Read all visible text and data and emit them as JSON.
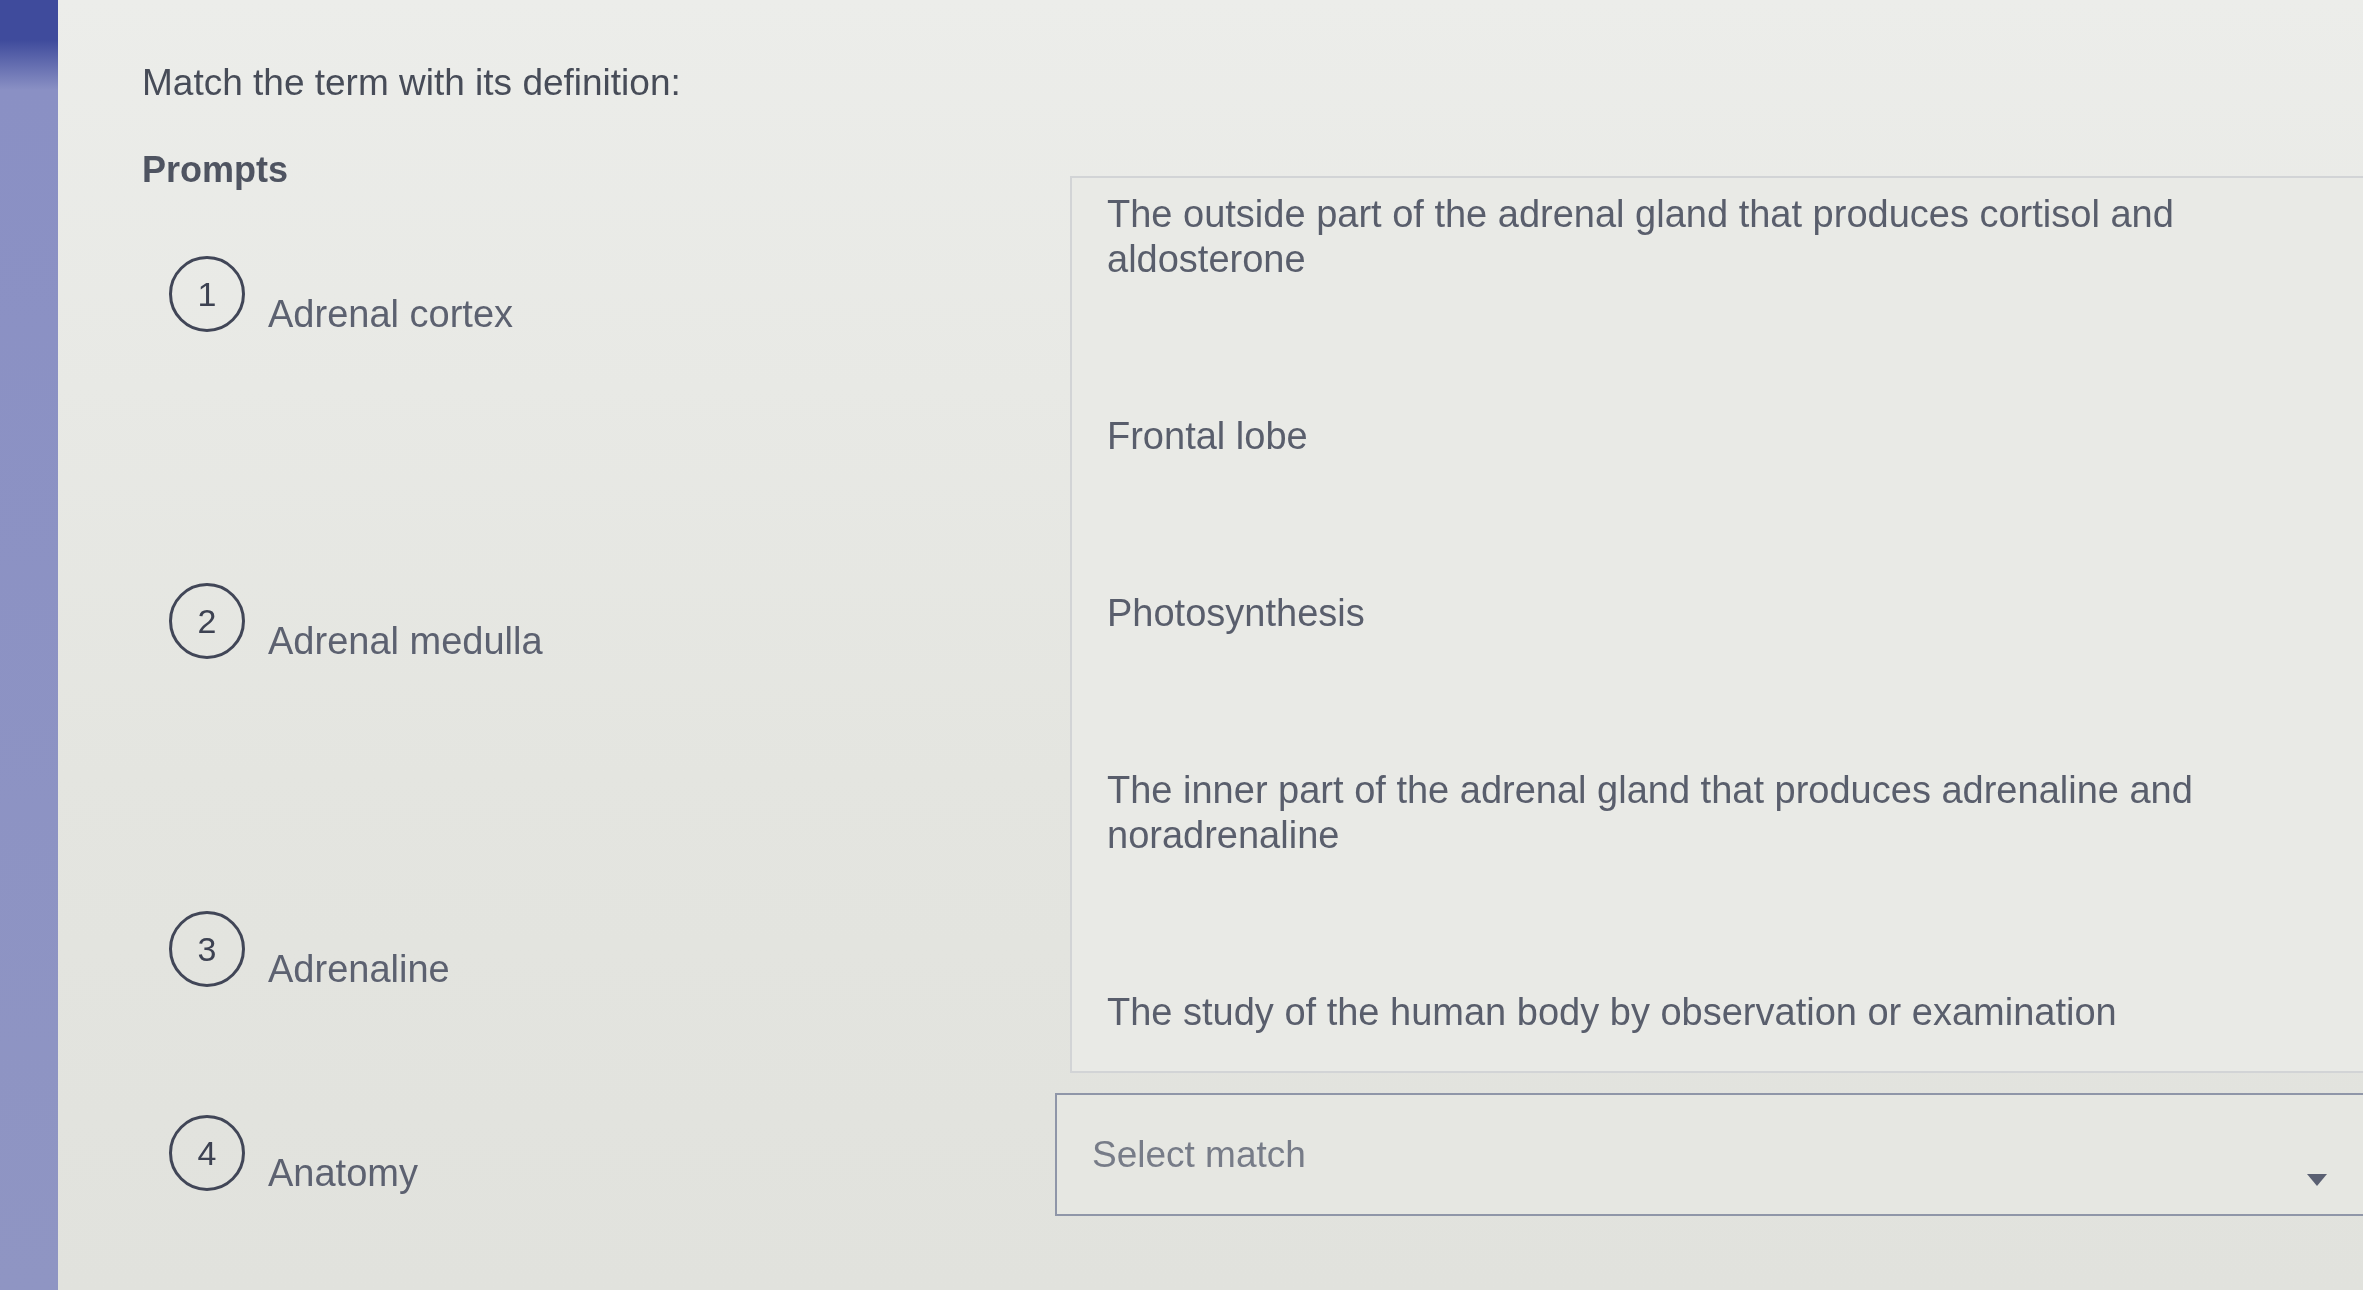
{
  "question": {
    "title": "Match the term with its definition:"
  },
  "prompts": {
    "heading": "Prompts",
    "items": [
      {
        "number": "1",
        "term": "Adrenal cortex"
      },
      {
        "number": "2",
        "term": "Adrenal medulla"
      },
      {
        "number": "3",
        "term": "Adrenaline"
      },
      {
        "number": "4",
        "term": "Anatomy"
      }
    ]
  },
  "match_select": {
    "placeholder": "Select match",
    "expanded": true,
    "options": [
      {
        "label": "The outside part of the adrenal gland that produces cortisol and aldosterone",
        "selected": false
      },
      {
        "label": "Frontal lobe",
        "selected": false
      },
      {
        "label": "Photosynthesis",
        "selected": false
      },
      {
        "label": "The inner part of the adrenal gland that produces adrenaline and noradrenaline",
        "selected": false
      },
      {
        "label": "The study of the human body by observation or examination",
        "selected": false
      }
    ]
  }
}
